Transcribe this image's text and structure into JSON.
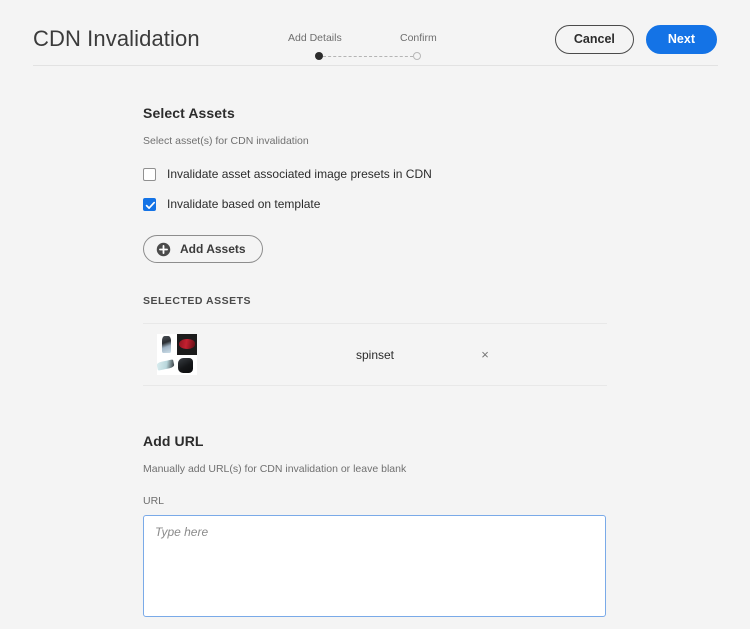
{
  "header": {
    "title": "CDN Invalidation",
    "steps": [
      {
        "label": "Add Details",
        "state": "active"
      },
      {
        "label": "Confirm",
        "state": "inactive"
      }
    ],
    "cancel_label": "Cancel",
    "next_label": "Next"
  },
  "select_assets": {
    "title": "Select Assets",
    "subtitle": "Select asset(s) for CDN invalidation",
    "checkboxes": [
      {
        "label": "Invalidate asset associated image presets in CDN",
        "checked": false
      },
      {
        "label": "Invalidate based on template",
        "checked": true
      }
    ],
    "add_assets_label": "Add Assets"
  },
  "selected_assets": {
    "heading": "SELECTED ASSETS",
    "items": [
      {
        "name": "spinset",
        "remove_label": "×"
      }
    ]
  },
  "add_url": {
    "title": "Add URL",
    "subtitle": "Manually add URL(s) for CDN invalidation or leave blank",
    "field_label": "URL",
    "placeholder": "Type here",
    "value": ""
  },
  "colors": {
    "accent_blue": "#1473E6",
    "page_background": "#F4F4F4",
    "focus_border": "#7AAAE8",
    "text_primary": "#2C2C2C",
    "text_secondary": "#6E6E6E"
  }
}
